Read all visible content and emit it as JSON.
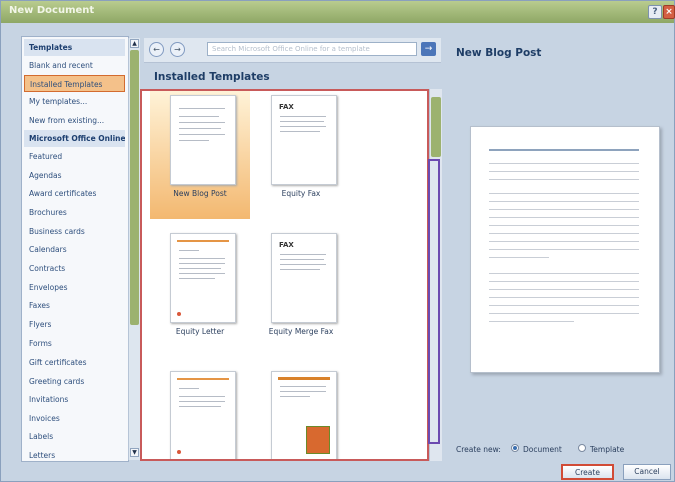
{
  "window": {
    "title": "New Document"
  },
  "left_nav": {
    "items": [
      {
        "label": "Templates",
        "header": true
      },
      {
        "label": "Blank and recent"
      },
      {
        "label": "Installed Templates",
        "selected": true
      },
      {
        "label": "My templates..."
      },
      {
        "label": "New from existing..."
      },
      {
        "label": "Microsoft Office Online",
        "header": true
      },
      {
        "label": "Featured"
      },
      {
        "label": "Agendas"
      },
      {
        "label": "Award certificates"
      },
      {
        "label": "Brochures"
      },
      {
        "label": "Business cards"
      },
      {
        "label": "Calendars"
      },
      {
        "label": "Contracts"
      },
      {
        "label": "Envelopes"
      },
      {
        "label": "Faxes"
      },
      {
        "label": "Flyers"
      },
      {
        "label": "Forms"
      },
      {
        "label": "Gift certificates"
      },
      {
        "label": "Greeting cards"
      },
      {
        "label": "Invitations"
      },
      {
        "label": "Invoices"
      },
      {
        "label": "Labels"
      },
      {
        "label": "Letters"
      }
    ]
  },
  "toolbar": {
    "search_placeholder": "Search Microsoft Office Online for a template"
  },
  "main": {
    "title": "Installed Templates",
    "templates": [
      {
        "label": "New Blog Post",
        "selected": true
      },
      {
        "label": "Equity Fax"
      },
      {
        "label": "Equity Letter"
      },
      {
        "label": "Equity Merge Fax"
      },
      {
        "label": ""
      },
      {
        "label": ""
      }
    ]
  },
  "preview": {
    "title": "New Blog Post"
  },
  "create_new": {
    "label": "Create new:",
    "options": [
      "Document",
      "Template"
    ],
    "selected": "Document"
  },
  "buttons": {
    "create": "Create",
    "cancel": "Cancel"
  },
  "colors": {
    "accent": "#9cb26f",
    "selection": "#f4c18a",
    "highlight_border": "#c85a5a"
  }
}
